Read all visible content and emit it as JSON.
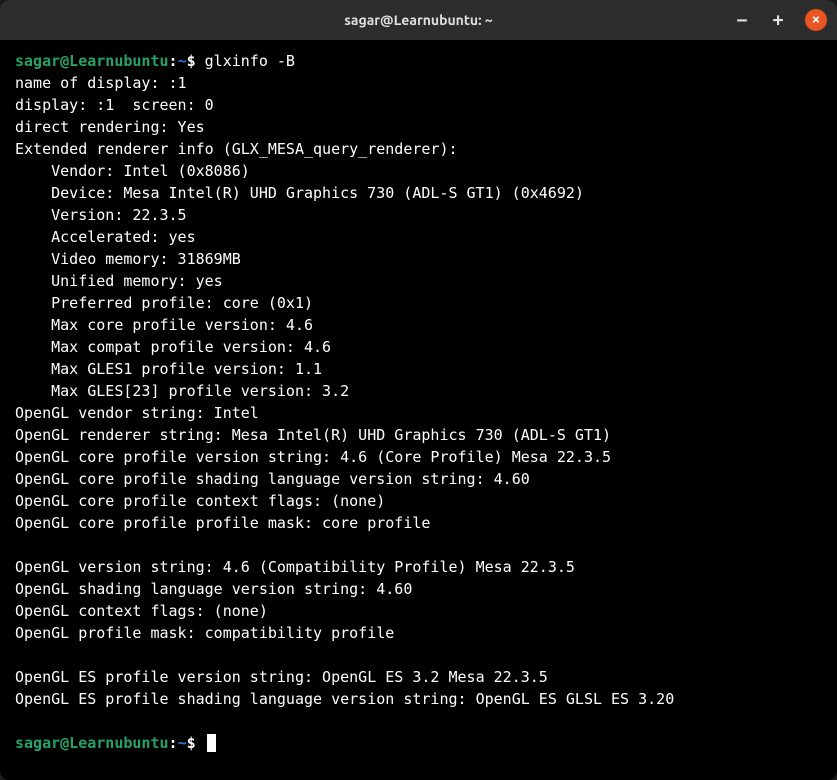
{
  "window": {
    "title": "sagar@Learnubuntu: ~"
  },
  "prompt": {
    "user_host": "sagar@Learnubuntu",
    "separator": ":",
    "path": "~",
    "symbol": "$"
  },
  "command": "glxinfo -B",
  "output": {
    "line1": "name of display: :1",
    "line2": "display: :1  screen: 0",
    "line3": "direct rendering: Yes",
    "line4": "Extended renderer info (GLX_MESA_query_renderer):",
    "line5": "Vendor: Intel (0x8086)",
    "line6": "Device: Mesa Intel(R) UHD Graphics 730 (ADL-S GT1) (0x4692)",
    "line7": "Version: 22.3.5",
    "line8": "Accelerated: yes",
    "line9": "Video memory: 31869MB",
    "line10": "Unified memory: yes",
    "line11": "Preferred profile: core (0x1)",
    "line12": "Max core profile version: 4.6",
    "line13": "Max compat profile version: 4.6",
    "line14": "Max GLES1 profile version: 1.1",
    "line15": "Max GLES[23] profile version: 3.2",
    "line16": "OpenGL vendor string: Intel",
    "line17": "OpenGL renderer string: Mesa Intel(R) UHD Graphics 730 (ADL-S GT1)",
    "line18": "OpenGL core profile version string: 4.6 (Core Profile) Mesa 22.3.5",
    "line19": "OpenGL core profile shading language version string: 4.60",
    "line20": "OpenGL core profile context flags: (none)",
    "line21": "OpenGL core profile profile mask: core profile",
    "line22": "OpenGL version string: 4.6 (Compatibility Profile) Mesa 22.3.5",
    "line23": "OpenGL shading language version string: 4.60",
    "line24": "OpenGL context flags: (none)",
    "line25": "OpenGL profile mask: compatibility profile",
    "line26": "OpenGL ES profile version string: OpenGL ES 3.2 Mesa 22.3.5",
    "line27": "OpenGL ES profile shading language version string: OpenGL ES GLSL ES 3.20"
  }
}
